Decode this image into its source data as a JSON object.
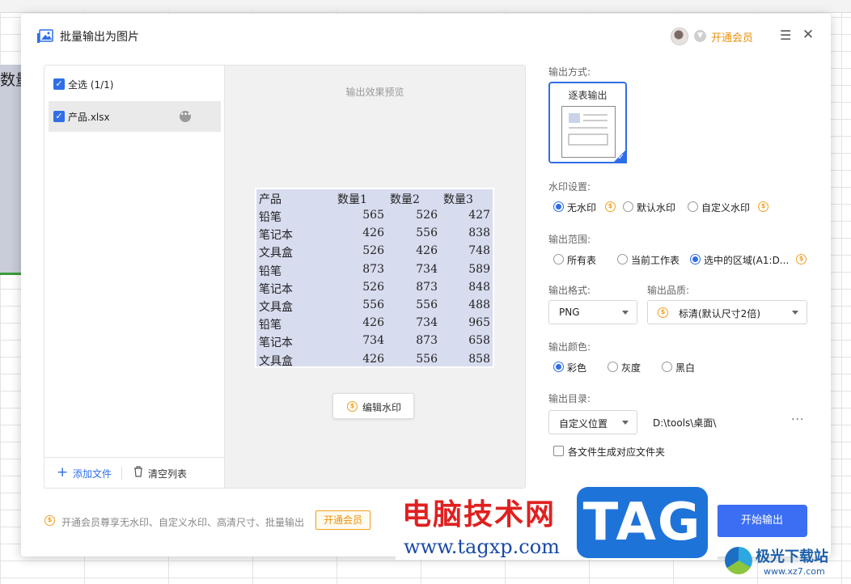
{
  "dialog": {
    "title": "批量输出为图片",
    "vip_label": "开通会员"
  },
  "background": {
    "cell_text": "数量"
  },
  "file_list": {
    "select_all_label": "全选 (1/1)",
    "files": [
      {
        "name": "产品.xlsx",
        "checked": true
      }
    ],
    "add_file_label": "添加文件",
    "clear_list_label": "清空列表"
  },
  "preview": {
    "label": "输出效果预览",
    "edit_watermark_label": "编辑水印",
    "table": {
      "headers": [
        "产品",
        "数量1",
        "数量2",
        "数量3"
      ],
      "rows": [
        [
          "铅笔",
          "565",
          "526",
          "427"
        ],
        [
          "笔记本",
          "426",
          "556",
          "838"
        ],
        [
          "文具盒",
          "526",
          "426",
          "748"
        ],
        [
          "铅笔",
          "873",
          "734",
          "589"
        ],
        [
          "笔记本",
          "526",
          "873",
          "848"
        ],
        [
          "文具盒",
          "556",
          "556",
          "488"
        ],
        [
          "铅笔",
          "426",
          "734",
          "965"
        ],
        [
          "笔记本",
          "734",
          "873",
          "658"
        ],
        [
          "文具盒",
          "426",
          "556",
          "858"
        ]
      ]
    }
  },
  "settings": {
    "output_mode": {
      "label": "输出方式:",
      "option": "逐表输出"
    },
    "watermark": {
      "label": "水印设置:",
      "options": [
        "无水印",
        "默认水印",
        "自定义水印"
      ],
      "selected": 0
    },
    "range": {
      "label": "输出范围:",
      "options": [
        "所有表",
        "当前工作表",
        "选中的区域(A1:D..."
      ],
      "selected": 2
    },
    "format": {
      "label": "输出格式:",
      "value": "PNG"
    },
    "quality": {
      "label": "输出品质:",
      "value": "标清(默认尺寸2倍)"
    },
    "color": {
      "label": "输出颜色:",
      "options": [
        "彩色",
        "灰度",
        "黑白"
      ],
      "selected": 0
    },
    "directory": {
      "label": "输出目录:",
      "value": "自定义位置",
      "path": "D:\\tools\\桌面\\",
      "more": "···"
    },
    "per_file_folder": {
      "label": "各文件生成对应文件夹",
      "checked": false
    }
  },
  "footer": {
    "promo_text": "开通会员尊享无水印、自定义水印、高清尺寸、批量输出",
    "promo_button": "开通会员",
    "start_button": "开始输出"
  },
  "overlay": {
    "site_cn": "电脑技术网",
    "site_url": "www.tagxp.com",
    "tag_logo": "TAG",
    "xz_cn": "极光下载站",
    "xz_url": "www.xz7.com"
  },
  "colors": {
    "accent": "#3b6ef3",
    "vip": "#e8930c",
    "preview_fill": "#d8dcef"
  }
}
